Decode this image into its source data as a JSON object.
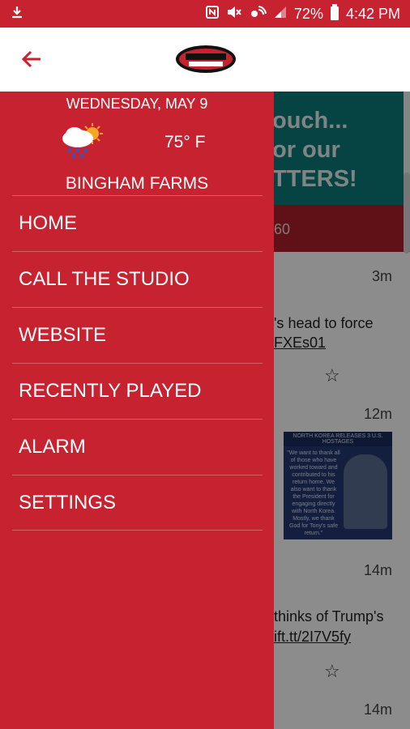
{
  "status": {
    "battery_percent": "72%",
    "time": "4:42 PM",
    "icons": [
      "download-icon",
      "nfc-icon",
      "mute-icon",
      "signal-icon",
      "wifi-call-icon",
      "battery-icon"
    ]
  },
  "appbar": {
    "back_icon": "arrow-left-icon",
    "logo_icon": "station-logo"
  },
  "drawer": {
    "date": "WEDNESDAY, MAY 9",
    "weather_icon": "rain-sun-icon",
    "temperature": "75° F",
    "city": "BINGHAM FARMS",
    "menu": [
      {
        "label": "HOME"
      },
      {
        "label": "CALL THE STUDIO"
      },
      {
        "label": "WEBSITE"
      },
      {
        "label": "RECENTLY PLAYED"
      },
      {
        "label": "ALARM"
      },
      {
        "label": "SETTINGS"
      }
    ]
  },
  "background": {
    "banner_lines": [
      "ouch...",
      "or our",
      "TTERS!"
    ],
    "tab_text": "60",
    "feed": [
      {
        "time": "3m",
        "text": "'s head to force",
        "link": "FXEs01"
      },
      {
        "time": "12m"
      },
      {
        "time": "14m",
        "text": "thinks of Trump's",
        "link": "ift.tt/2I7V5fy"
      },
      {
        "time": "14m"
      }
    ],
    "poster_header": "NORTH KOREA RELEASES 3 U.S. HOSTAGES",
    "poster_quote": "\"We want to thank all of those who have worked toward and contributed to his return home. We also want to thank the President for engaging directly with North Korea. Mostly, we thank God for Tony's safe return.\""
  },
  "colors": {
    "brand_red": "#c6222f",
    "banner_teal": "#0c7a7a"
  }
}
